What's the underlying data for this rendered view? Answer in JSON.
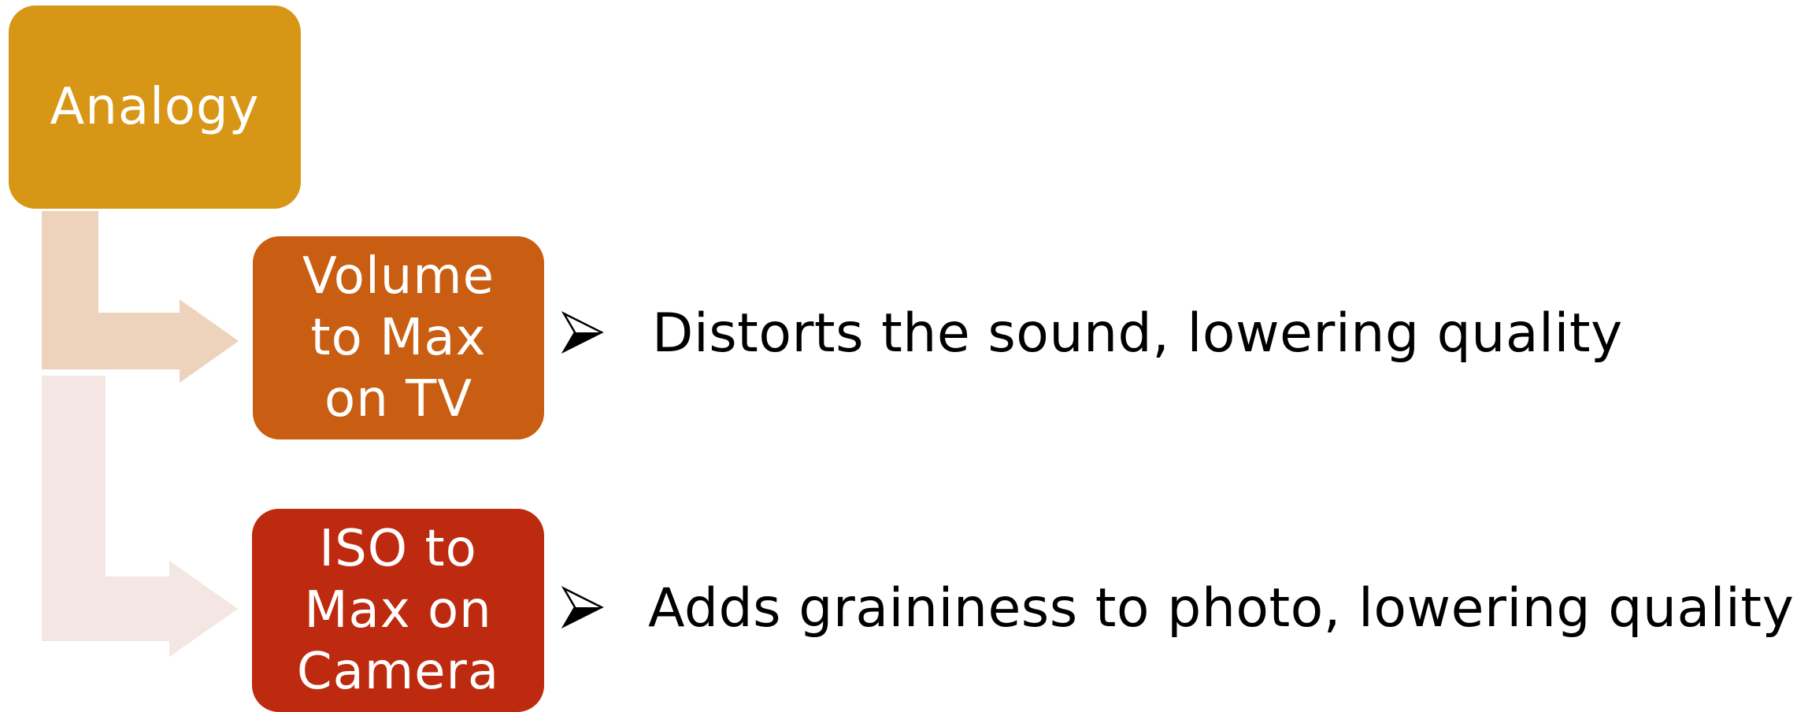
{
  "diagram": {
    "root": {
      "label": "Analogy",
      "color": "#d89616"
    },
    "children": [
      {
        "label_lines": [
          "Volume",
          "to Max",
          "on TV"
        ],
        "color": "#c95e12",
        "connector_color": "#edd3bc",
        "description": "Distorts the sound, lowering quality"
      },
      {
        "label_lines": [
          "ISO to",
          "Max on",
          "Camera"
        ],
        "color": "#bd2a0f",
        "connector_color": "#f4e6e3",
        "description": "Adds graininess to photo, lowering quality"
      }
    ],
    "bullet_icon": "arrowhead-bullet-icon"
  }
}
